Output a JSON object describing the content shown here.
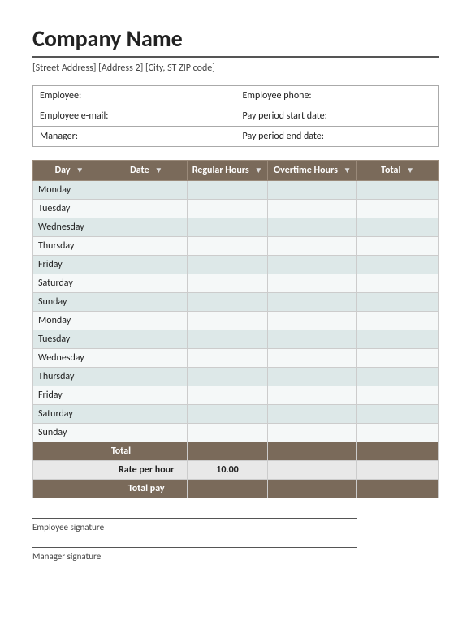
{
  "company": {
    "name": "Company Name",
    "address": "[Street Address] [Address 2] [City, ST ZIP code]"
  },
  "info_fields": [
    {
      "label": "Employee:",
      "value": ""
    },
    {
      "label": "Employee phone:",
      "value": ""
    },
    {
      "label": "Employee e-mail:",
      "value": ""
    },
    {
      "label": "Pay period start date:",
      "value": ""
    },
    {
      "label": "Manager:",
      "value": ""
    },
    {
      "label": "Pay period end date:",
      "value": ""
    }
  ],
  "table_headers": {
    "day": "Day",
    "date": "Date",
    "regular_hours": "Regular Hours",
    "overtime_hours": "Overtime Hours",
    "total": "Total"
  },
  "days": [
    "Monday",
    "Tuesday",
    "Wednesday",
    "Thursday",
    "Friday",
    "Saturday",
    "Sunday",
    "Monday",
    "Tuesday",
    "Wednesday",
    "Thursday",
    "Friday",
    "Saturday",
    "Sunday"
  ],
  "footer_rows": {
    "total_label": "Total",
    "rate_label": "Rate per hour",
    "rate_value": "10.00",
    "total_pay_label": "Total pay"
  },
  "signatures": {
    "employee": "Employee signature",
    "manager": "Manager signature"
  }
}
